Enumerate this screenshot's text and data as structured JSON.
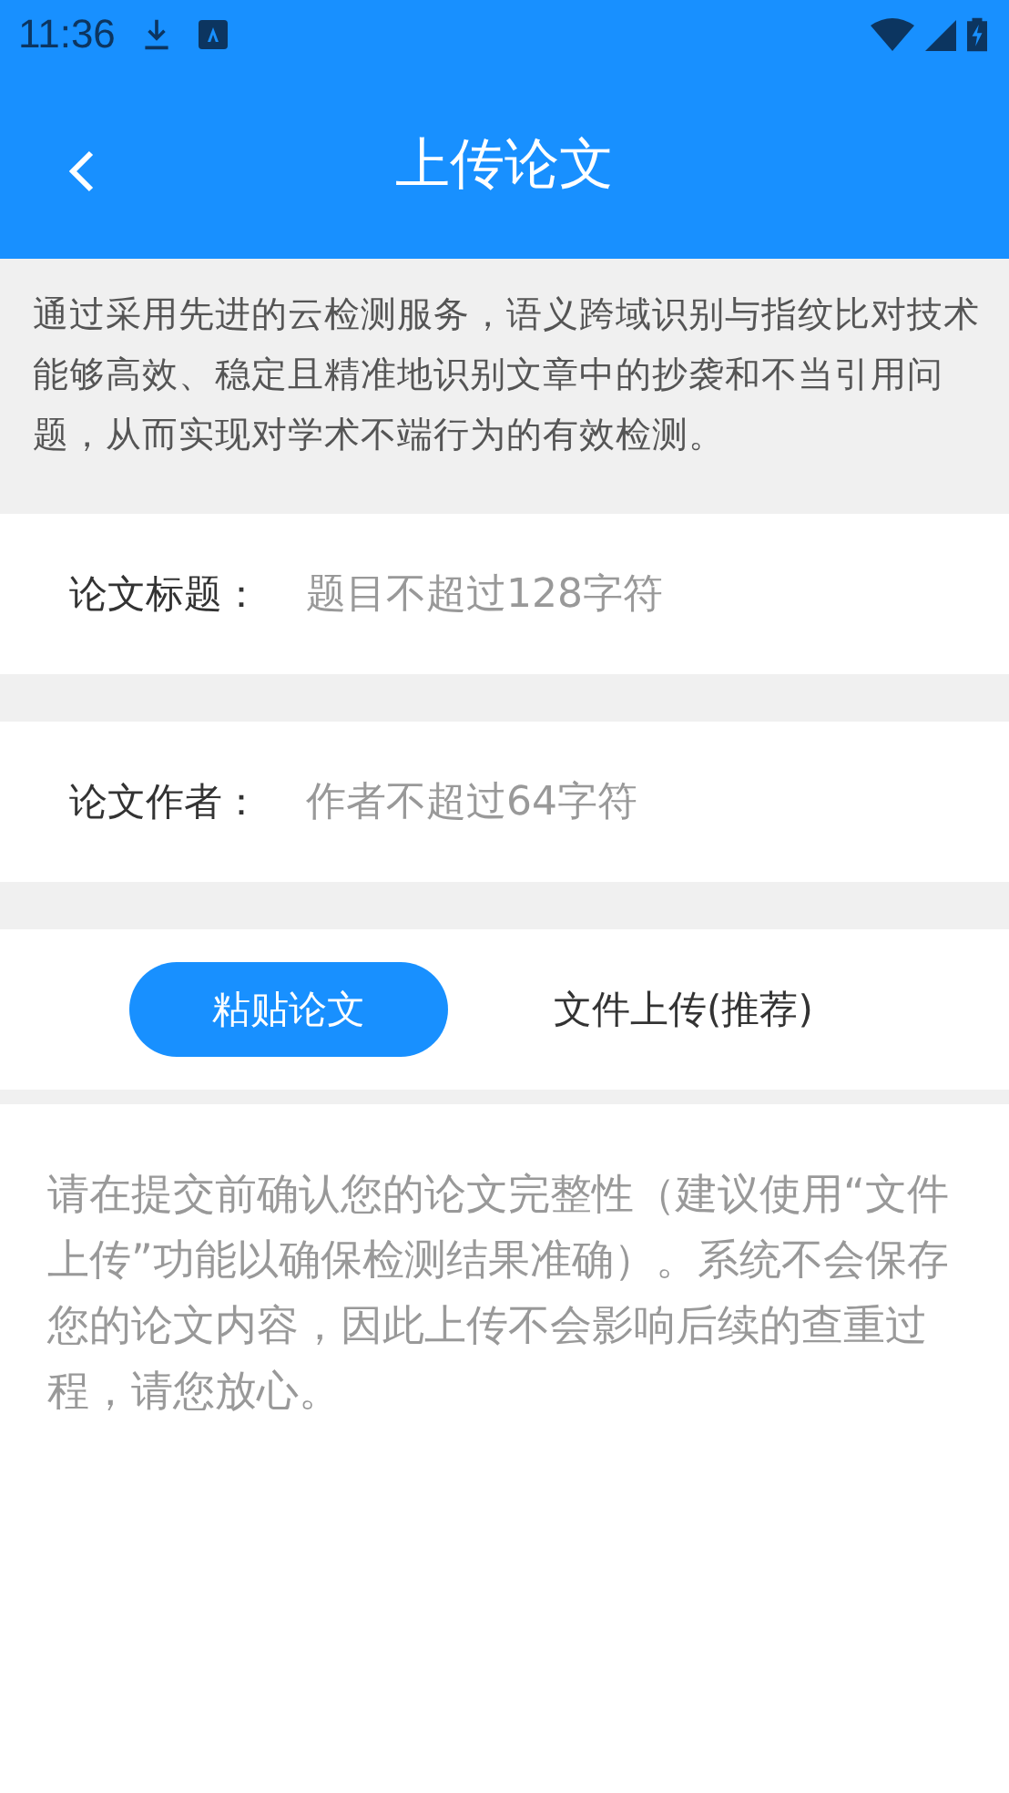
{
  "status_bar": {
    "time": "11:36"
  },
  "app_bar": {
    "title": "上传论文"
  },
  "intro": "通过采用先进的云检测服务，语义跨域识别与指纹比对技术能够高效、稳定且精准地识别文章中的抄袭和不当引用问题，从而实现对学术不端行为的有效检测。",
  "fields": [
    {
      "label": "论文标题：",
      "placeholder": "题目不超过128字符"
    },
    {
      "label": "论文作者：",
      "placeholder": "作者不超过64字符"
    }
  ],
  "tabs": [
    {
      "label": "粘贴论文",
      "selected": true
    },
    {
      "label": "文件上传(推荐)",
      "selected": false
    }
  ],
  "note": "请在提交前确认您的论文完整性（建议使用“文件上传”功能以确保检测结果准确）。系统不会保存您的论文内容，因此上传不会影响后续的查重过程，请您放心。"
}
